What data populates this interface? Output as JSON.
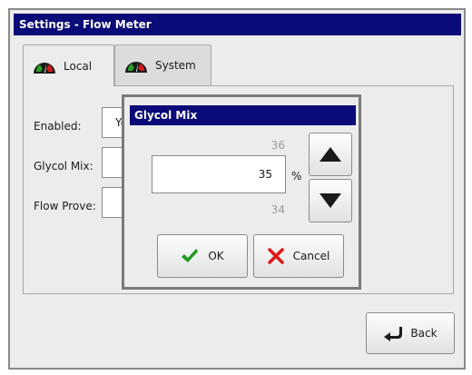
{
  "window": {
    "title": "Settings - Flow Meter"
  },
  "tabs": [
    {
      "label": "Local",
      "icon": "gauge-icon",
      "active": true
    },
    {
      "label": "System",
      "icon": "gauge-icon",
      "active": false
    }
  ],
  "fields": [
    {
      "label": "Enabled:",
      "value": "Yes"
    },
    {
      "label": "Glycol Mix:",
      "value": ""
    },
    {
      "label": "Flow Prove:",
      "value": ""
    }
  ],
  "dialog": {
    "title": "Glycol Mix",
    "next_value": "36",
    "current_value": "35",
    "prev_value": "34",
    "unit": "%",
    "ok_label": "OK",
    "cancel_label": "Cancel"
  },
  "footer": {
    "back_label": "Back"
  },
  "colors": {
    "title_bar": "#0a0a78",
    "ok_check": "#1e9a1e",
    "cancel_x": "#e01818",
    "gauge_body": "#1a1a1a",
    "gauge_red": "#d21a1a",
    "gauge_green": "#2aa02a"
  }
}
